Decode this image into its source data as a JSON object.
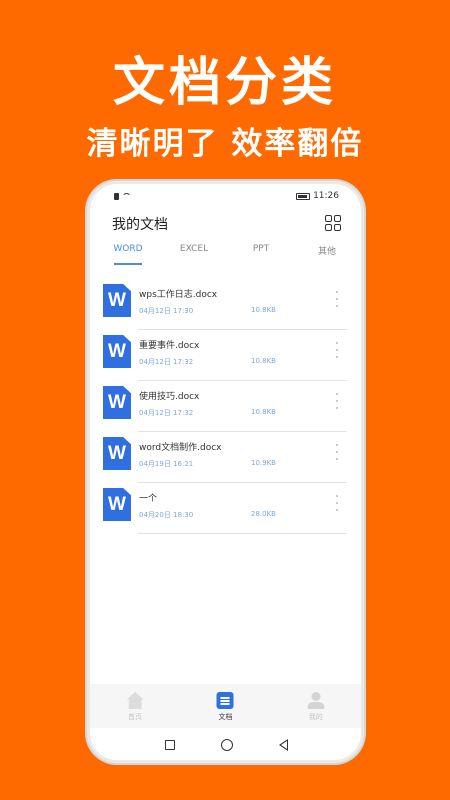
{
  "banner": {
    "headline": "文档分类",
    "subline": "清晰明了 效率翻倍"
  },
  "status_bar": {
    "time": "11:26"
  },
  "app": {
    "title": "我的文档"
  },
  "tabs": [
    {
      "label": "WORD",
      "active": true
    },
    {
      "label": "EXCEL",
      "active": false
    },
    {
      "label": "PPT",
      "active": false
    },
    {
      "label": "其他",
      "active": false
    }
  ],
  "files": [
    {
      "icon": "word-doc-icon",
      "name": "wps工作日志.docx",
      "date": "04月12日 17:30",
      "size": "10.8KB"
    },
    {
      "icon": "word-doc-icon",
      "name": "重要事件.docx",
      "date": "04月12日 17:32",
      "size": "10.8KB"
    },
    {
      "icon": "word-doc-icon",
      "name": "使用技巧.docx",
      "date": "04月12日 17:32",
      "size": "10.8KB"
    },
    {
      "icon": "word-doc-icon",
      "name": "word文档制作.docx",
      "date": "04月19日 16:21",
      "size": "10.9KB"
    },
    {
      "icon": "word-doc-icon",
      "name": "一个",
      "date": "04月20日 18:30",
      "size": "28.0KB"
    }
  ],
  "bottom_nav": [
    {
      "label": "首页",
      "icon": "home-icon",
      "active": false
    },
    {
      "label": "文档",
      "icon": "document-icon",
      "active": true
    },
    {
      "label": "我的",
      "icon": "user-icon",
      "active": false
    }
  ],
  "doc_icon_letter": "W",
  "colors": {
    "background": "#ff6a00",
    "accent": "#4c8be8",
    "doc_blue": "#2f6fe0"
  }
}
